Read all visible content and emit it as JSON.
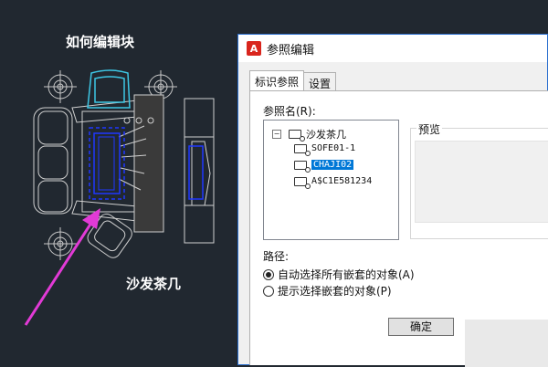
{
  "cad": {
    "title": "如何编辑块",
    "caption": "沙发茶几"
  },
  "dialog": {
    "title": "参照编辑",
    "tabs": [
      {
        "label": "标识参照"
      },
      {
        "label": "设置"
      }
    ],
    "ref_name_label": "参照名(R):",
    "tree": [
      {
        "label": "沙发茶几"
      },
      {
        "label": "SOFE01-1"
      },
      {
        "label": "CHAJI02"
      },
      {
        "label": "A$C1E581234"
      }
    ],
    "preview_label": "预览",
    "path_label": "路径:",
    "options": [
      {
        "label": "自动选择所有嵌套的对象(A)",
        "selected": true
      },
      {
        "label": "提示选择嵌套的对象(P)",
        "selected": false
      }
    ],
    "ok_button": "确定"
  },
  "colors": {
    "canvas": "#212830",
    "accent": "#0078d7",
    "annotation_arrow": "#e23ad6",
    "block_highlight": "#1f37ff",
    "cyan_block": "#3ec8e6"
  }
}
